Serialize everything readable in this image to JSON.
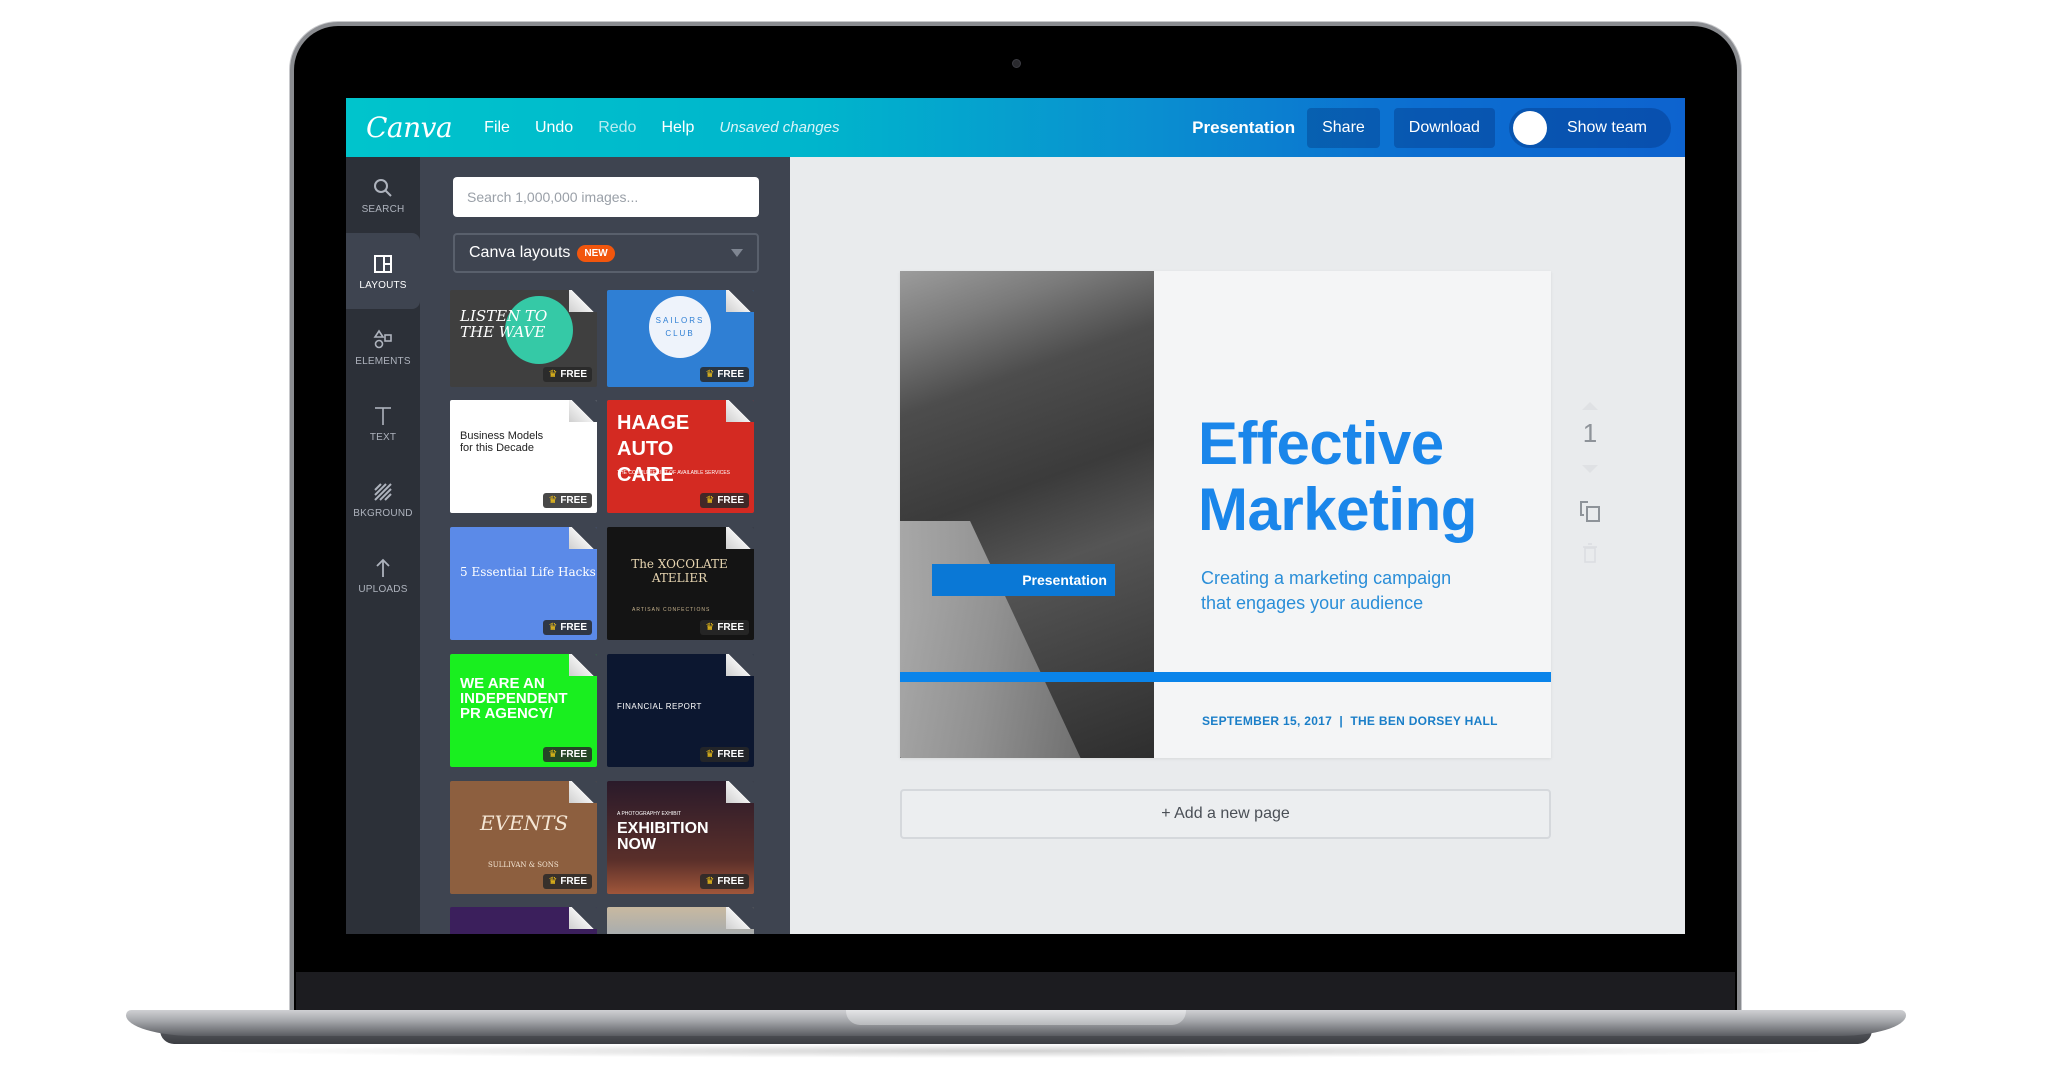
{
  "app": {
    "logo": "Canva",
    "menu": [
      {
        "label": "File",
        "enabled": true
      },
      {
        "label": "Undo",
        "enabled": true
      },
      {
        "label": "Redo",
        "enabled": false
      },
      {
        "label": "Help",
        "enabled": true
      }
    ],
    "status": "Unsaved changes",
    "doc_title": "Presentation",
    "share_label": "Share",
    "download_label": "Download",
    "show_team_label": "Show team"
  },
  "rail": {
    "items": [
      {
        "label": "SEARCH",
        "icon": "search-icon"
      },
      {
        "label": "LAYOUTS",
        "icon": "layouts-icon",
        "active": true
      },
      {
        "label": "ELEMENTS",
        "icon": "elements-icon"
      },
      {
        "label": "TEXT",
        "icon": "text-icon"
      },
      {
        "label": "BKGROUND",
        "icon": "background-icon"
      },
      {
        "label": "UPLOADS",
        "icon": "upload-icon"
      }
    ]
  },
  "panel": {
    "search_placeholder": "Search 1,000,000 images...",
    "dropdown_label": "Canva layouts",
    "dropdown_badge": "NEW",
    "free_label": "FREE",
    "templates": [
      {
        "title": "LISTEN TO THE WAVE",
        "free": true
      },
      {
        "title": "SAILORS CLUB",
        "free": true
      },
      {
        "title": "Business Models for this Decade",
        "free": true
      },
      {
        "title": "HAAGE AUTO CARE",
        "subtitle": "THE COMPLETE LIST OF AVAILABLE SERVICES",
        "free": true
      },
      {
        "title": "5 Essential Life Hacks",
        "free": true
      },
      {
        "title": "The XOCOLATE ATELIER",
        "subtitle": "ARTISAN CONFECTIONS",
        "free": true
      },
      {
        "title": "WE ARE AN INDEPENDENT PR AGENCY/",
        "free": true
      },
      {
        "title": "FINANCIAL REPORT",
        "free": true
      },
      {
        "title": "EVENTS",
        "subtitle": "SULLIVAN & SONS",
        "free": true
      },
      {
        "title": "EXHIBITION NOW",
        "subtitle": "A PHOTOGRAPHY EXHIBIT",
        "free": true
      },
      {
        "title": "",
        "free": false
      },
      {
        "title": "",
        "free": false
      }
    ]
  },
  "slide": {
    "tag": "Presentation",
    "title_line1": "Effective",
    "title_line2": "Marketing",
    "subtitle_line1": "Creating a marketing campaign",
    "subtitle_line2": "that engages your audience",
    "footer": "SEPTEMBER 15, 2017  |  THE BEN DORSEY HALL",
    "accent": "#1a86ea"
  },
  "page_tools": {
    "page_number": "1"
  },
  "add_page_label": "+ Add a new page"
}
